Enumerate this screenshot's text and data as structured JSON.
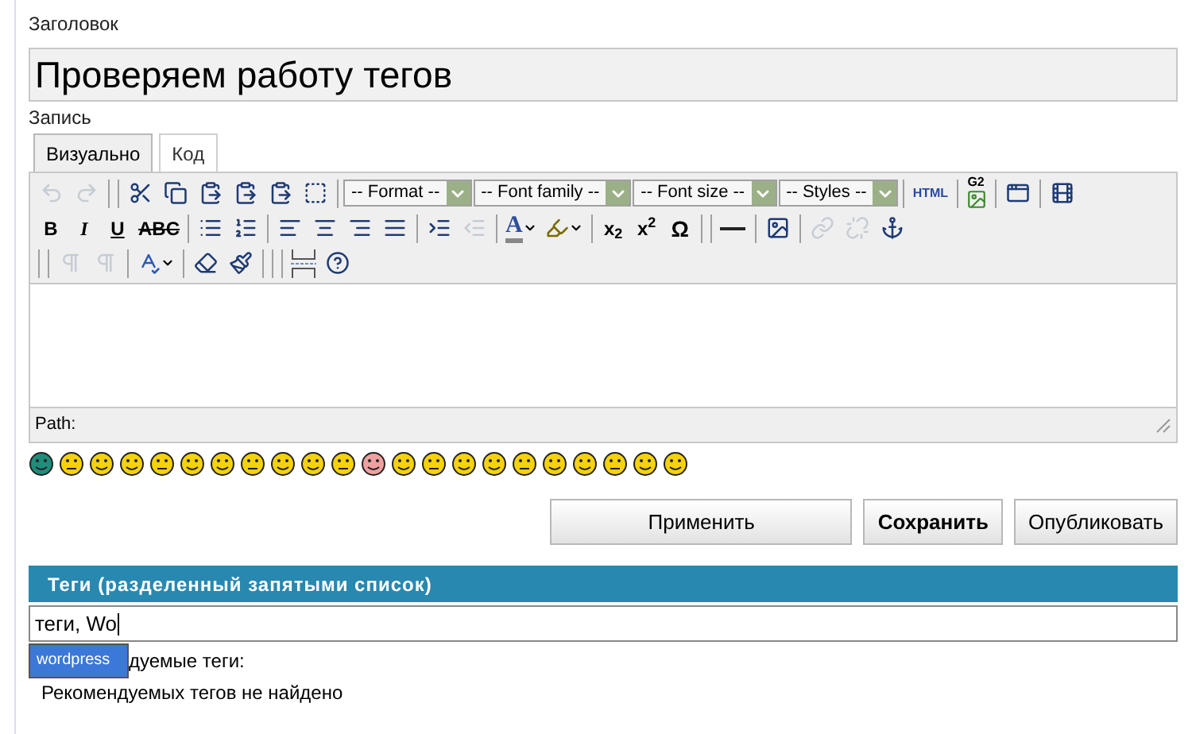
{
  "title_field": {
    "label": "Заголовок",
    "value": "Проверяем работу тегов"
  },
  "entry_label": "Запись",
  "tabs": [
    {
      "label": "Визуально",
      "selected": true
    },
    {
      "label": "Код",
      "selected": false
    }
  ],
  "toolbar": [
    [
      {
        "kind": "undo",
        "disabled": true
      },
      {
        "kind": "redo",
        "disabled": true
      },
      {
        "kind": "sep"
      },
      {
        "kind": "sep"
      },
      {
        "kind": "cut",
        "disabled": false
      },
      {
        "kind": "copy",
        "disabled": false
      },
      {
        "kind": "paste",
        "disabled": false
      },
      {
        "kind": "paste",
        "disabled": false
      },
      {
        "kind": "paste",
        "disabled": false
      },
      {
        "kind": "select-all",
        "disabled": false
      },
      {
        "kind": "sep"
      },
      {
        "kind": "select",
        "label": "-- Format --"
      },
      {
        "kind": "select",
        "label": "-- Font family --"
      },
      {
        "kind": "select",
        "label": "-- Font size --"
      },
      {
        "kind": "select",
        "label": "-- Styles --"
      },
      {
        "kind": "sep"
      },
      {
        "kind": "small-text",
        "label": "HTML",
        "disabled": false
      },
      {
        "kind": "sep"
      },
      {
        "kind": "labeled-image",
        "label": "G2",
        "disabled": false
      },
      {
        "kind": "sep"
      },
      {
        "kind": "windows",
        "disabled": false
      },
      {
        "kind": "sep"
      },
      {
        "kind": "media",
        "disabled": false
      }
    ],
    [
      {
        "kind": "bold",
        "label": "B",
        "disabled": false
      },
      {
        "kind": "italic",
        "label": "I",
        "disabled": false
      },
      {
        "kind": "underline",
        "label": "U",
        "disabled": false
      },
      {
        "kind": "strike",
        "label": "ABC",
        "disabled": false
      },
      {
        "kind": "sep"
      },
      {
        "kind": "bullets",
        "disabled": false
      },
      {
        "kind": "numbers",
        "disabled": false
      },
      {
        "kind": "sep"
      },
      {
        "kind": "align-left",
        "disabled": false
      },
      {
        "kind": "align-center",
        "disabled": false
      },
      {
        "kind": "align-right",
        "disabled": false
      },
      {
        "kind": "align-justify",
        "disabled": false
      },
      {
        "kind": "sep"
      },
      {
        "kind": "indent",
        "disabled": false
      },
      {
        "kind": "outdent",
        "disabled": true
      },
      {
        "kind": "sep"
      },
      {
        "kind": "text-color",
        "label": "A",
        "disabled": false
      },
      {
        "kind": "highlight",
        "disabled": false
      },
      {
        "kind": "sep"
      },
      {
        "kind": "subscript",
        "label": "x$_{2}$",
        "disabled": false
      },
      {
        "kind": "superscript",
        "label": "x$^{2}$",
        "disabled": false
      },
      {
        "kind": "symbol",
        "label": "Ω",
        "disabled": false
      },
      {
        "kind": "sep"
      },
      {
        "kind": "sep"
      },
      {
        "kind": "rule",
        "disabled": false
      },
      {
        "kind": "sep"
      },
      {
        "kind": "image",
        "disabled": false
      },
      {
        "kind": "sep"
      },
      {
        "kind": "link",
        "disabled": true
      },
      {
        "kind": "unlink",
        "disabled": true
      },
      {
        "kind": "anchor",
        "disabled": false
      }
    ],
    [
      {
        "kind": "sep"
      },
      {
        "kind": "sep"
      },
      {
        "kind": "ltr",
        "disabled": true
      },
      {
        "kind": "rtl",
        "disabled": true
      },
      {
        "kind": "sep"
      },
      {
        "kind": "spellcheck",
        "disabled": false
      },
      {
        "kind": "sep"
      },
      {
        "kind": "eraser",
        "disabled": false
      },
      {
        "kind": "brush",
        "disabled": false
      },
      {
        "kind": "sep"
      },
      {
        "kind": "sep"
      },
      {
        "kind": "sep"
      },
      {
        "kind": "page-break",
        "disabled": false
      },
      {
        "kind": "help",
        "disabled": false
      }
    ]
  ],
  "path_label": "Path:",
  "buttons": [
    {
      "label": "Применить",
      "bold": false
    },
    {
      "label": "Сохранить",
      "bold": true
    },
    {
      "label": "Опубликовать",
      "bold": false
    }
  ],
  "tags": {
    "header": "Теги (разделенный запятыми список)",
    "value": "теги, Wo",
    "suggestion": {
      "label": "wordpress",
      "selected": true
    },
    "recommended_label": "дуемые теги:",
    "recommended_text": "Рекомендуемых тегов не найдено"
  }
}
